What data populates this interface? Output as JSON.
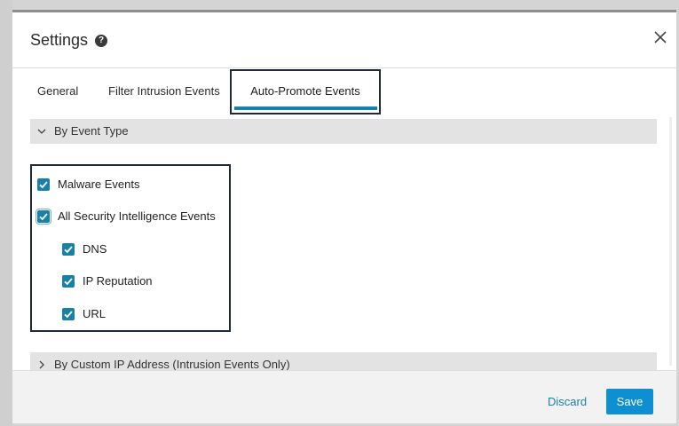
{
  "dialog": {
    "title": "Settings",
    "help_icon": "help-icon",
    "close_icon": "close-icon"
  },
  "tabs": [
    {
      "label": "General",
      "active": false
    },
    {
      "label": "Filter Intrusion Events",
      "active": false
    },
    {
      "label": "Auto-Promote Events",
      "active": true
    }
  ],
  "sections": [
    {
      "label": "By Event Type",
      "expanded": true,
      "icon": "chevron-down-icon"
    },
    {
      "label": "By Custom IP Address (Intrusion Events Only)",
      "expanded": false,
      "icon": "chevron-right-icon"
    }
  ],
  "event_types": [
    {
      "label": "Malware Events",
      "checked": true,
      "indent": 0
    },
    {
      "label": "All Security Intelligence Events",
      "checked": true,
      "indent": 0
    },
    {
      "label": "DNS",
      "checked": true,
      "indent": 1
    },
    {
      "label": "IP Reputation",
      "checked": true,
      "indent": 1
    },
    {
      "label": "URL",
      "checked": true,
      "indent": 1
    }
  ],
  "footer": {
    "discard_label": "Discard",
    "save_label": "Save"
  },
  "colors": {
    "accent": "#1a80a8",
    "save_button": "#0d8fd1",
    "section_bar": "#e3e3e3",
    "highlight_box": "#1f2a37"
  }
}
